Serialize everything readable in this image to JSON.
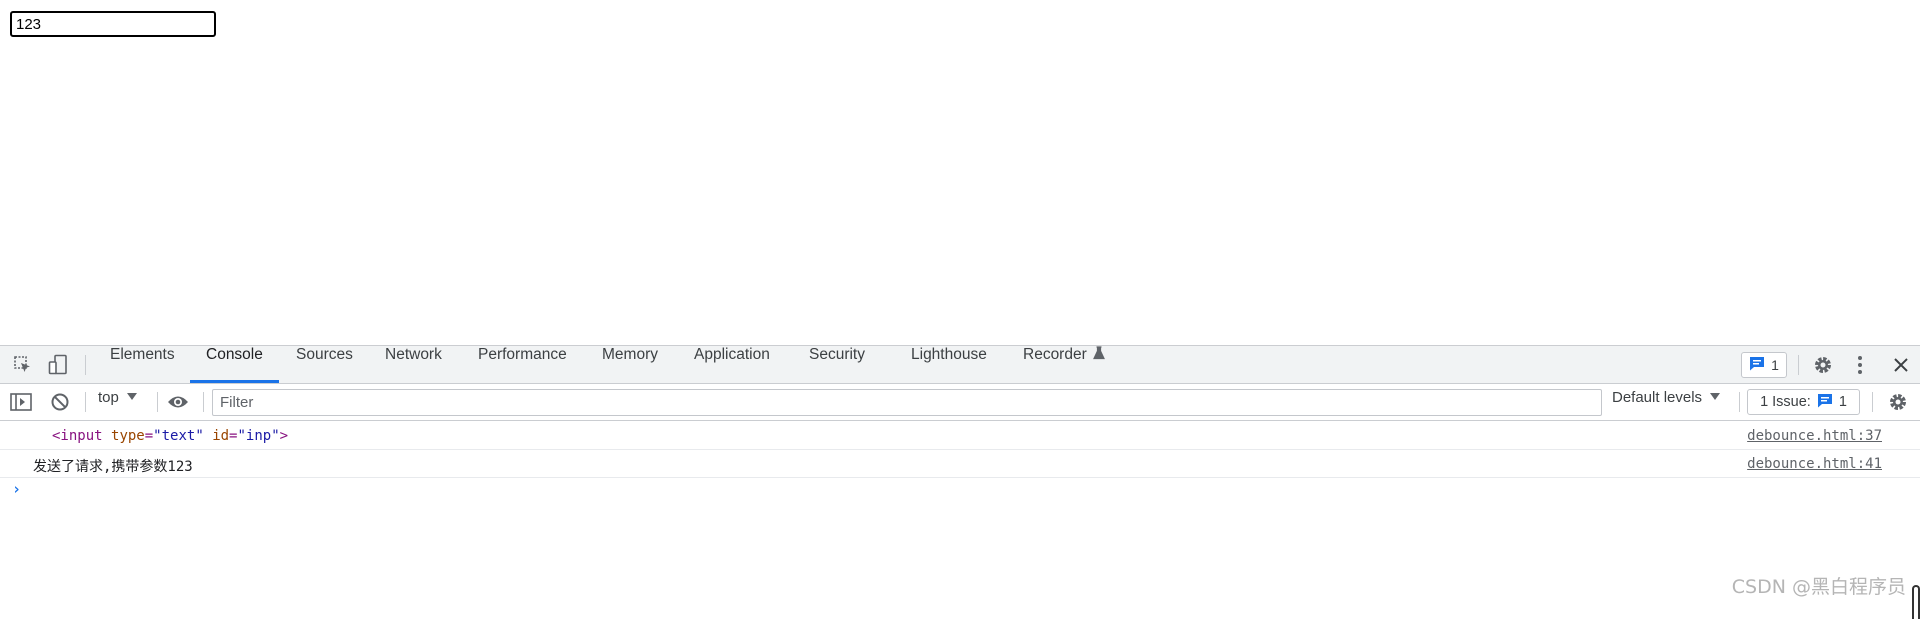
{
  "page": {
    "input_value": "123"
  },
  "devtools": {
    "tabs": [
      {
        "label": "Elements"
      },
      {
        "label": "Console"
      },
      {
        "label": "Sources"
      },
      {
        "label": "Network"
      },
      {
        "label": "Performance"
      },
      {
        "label": "Memory"
      },
      {
        "label": "Application"
      },
      {
        "label": "Security"
      },
      {
        "label": "Lighthouse"
      },
      {
        "label": "Recorder"
      }
    ],
    "active_tab": "Console",
    "message_badge_count": "1",
    "toolbar": {
      "context": "top",
      "filter_placeholder": "Filter",
      "levels": "Default levels",
      "issues_label": "1 Issue:",
      "issues_count": "1"
    },
    "console": {
      "rows": [
        {
          "tag_open": "<input",
          "attr1_name": "type",
          "attr1_value": "\"text\"",
          "attr2_name": "id",
          "attr2_value": "\"inp\"",
          "tag_close": ">",
          "source": "debounce.html:37"
        },
        {
          "text": "发送了请求,携带参数123",
          "source": "debounce.html:41"
        }
      ],
      "prompt": "›"
    },
    "icons": {
      "inspect": "inspect-element-icon",
      "device": "device-toolbar-icon",
      "sidebar": "console-sidebar-icon",
      "clear": "clear-console-icon",
      "eye": "live-expression-eye-icon",
      "settings": "gear-icon",
      "more": "kebab-menu-icon",
      "close": "close-icon",
      "message": "message-icon",
      "flask": "flask-icon"
    },
    "colors": {
      "accent": "#1a73e8",
      "tag": "#881280",
      "attr_name": "#994500",
      "attr_value": "#1a1aa6"
    }
  },
  "watermark": "CSDN @黑白程序员"
}
